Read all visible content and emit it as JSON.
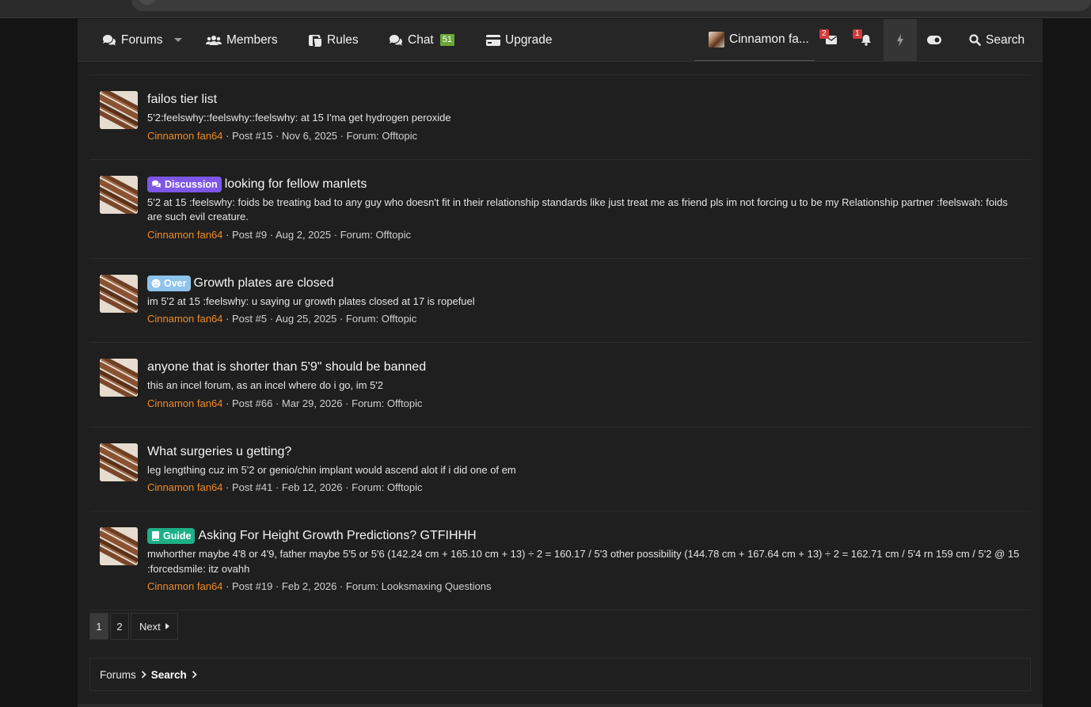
{
  "nav": {
    "forums": "Forums",
    "members": "Members",
    "rules": "Rules",
    "chat": "Chat",
    "chat_count": "51",
    "upgrade": "Upgrade",
    "user": "Cinnamon fa...",
    "inbox_count": "2",
    "alerts_count": "1",
    "search": "Search"
  },
  "results": [
    {
      "label": "",
      "title": "failos tier list",
      "snippet": "5'2:feelswhy::feelswhy::feelswhy: at 15 I'ma get hydrogen peroxide",
      "author": "Cinnamon fan64",
      "post": "Post #15",
      "date": "Nov 6, 2025",
      "forum_prefix": "Forum:",
      "forum": "Offtopic"
    },
    {
      "label": "Discussion",
      "title": "looking for fellow manlets",
      "snippet": "5'2 at 15 :feelswhy: foids be treating bad to any guy who doesn't fit in their relationship standards like just treat me as friend pls im not forcing u to be my Relationship partner :feelswah: foids are such evil creature.",
      "author": "Cinnamon fan64",
      "post": "Post #9",
      "date": "Aug 2, 2025",
      "forum_prefix": "Forum:",
      "forum": "Offtopic"
    },
    {
      "label": "Over",
      "title": "Growth plates are closed",
      "snippet": "im 5'2 at 15 :feelswhy: u saying ur growth plates closed at 17 is ropefuel",
      "author": "Cinnamon fan64",
      "post": "Post #5",
      "date": "Aug 25, 2025",
      "forum_prefix": "Forum:",
      "forum": "Offtopic"
    },
    {
      "label": "",
      "title": "anyone that is shorter than 5'9\" should be banned",
      "snippet": "this an incel forum, as an incel where do i go, im 5'2",
      "author": "Cinnamon fan64",
      "post": "Post #66",
      "date": "Mar 29, 2026",
      "forum_prefix": "Forum:",
      "forum": "Offtopic"
    },
    {
      "label": "",
      "title": "What surgeries u getting?",
      "snippet": "leg lengthing cuz im 5'2 or genio/chin implant would ascend alot if i did one of em",
      "author": "Cinnamon fan64",
      "post": "Post #41",
      "date": "Feb 12, 2026",
      "forum_prefix": "Forum:",
      "forum": "Offtopic"
    },
    {
      "label": "Guide",
      "title": "Asking For Height Growth Predictions? GTFIHHH",
      "snippet": "mwhorther maybe 4'8 or 4'9, father maybe 5'5 or 5'6 (142.24 cm + 165.10 cm + 13) ÷ 2 = 160.17 / 5'3 other possibility (144.78 cm + 167.64 cm + 13) ÷ 2 = 162.71 cm / 5'4 rn 159 cm / 5'2 @ 15 :forcedsmile: itz ovahh",
      "author": "Cinnamon fan64",
      "post": "Post #19",
      "date": "Feb 2, 2026",
      "forum_prefix": "Forum:",
      "forum": "Looksmaxing Questions"
    }
  ],
  "separator": "·",
  "pagination": {
    "page1": "1",
    "page2": "2",
    "next": "Next"
  },
  "breadcrumb": {
    "root": "Forums",
    "current": "Search"
  },
  "colors": {
    "author": "#f08a24",
    "discussion": "#7e57e6",
    "over": "#8ec3ec",
    "guide": "#1eb087",
    "chat_badge": "#6aa73a"
  }
}
